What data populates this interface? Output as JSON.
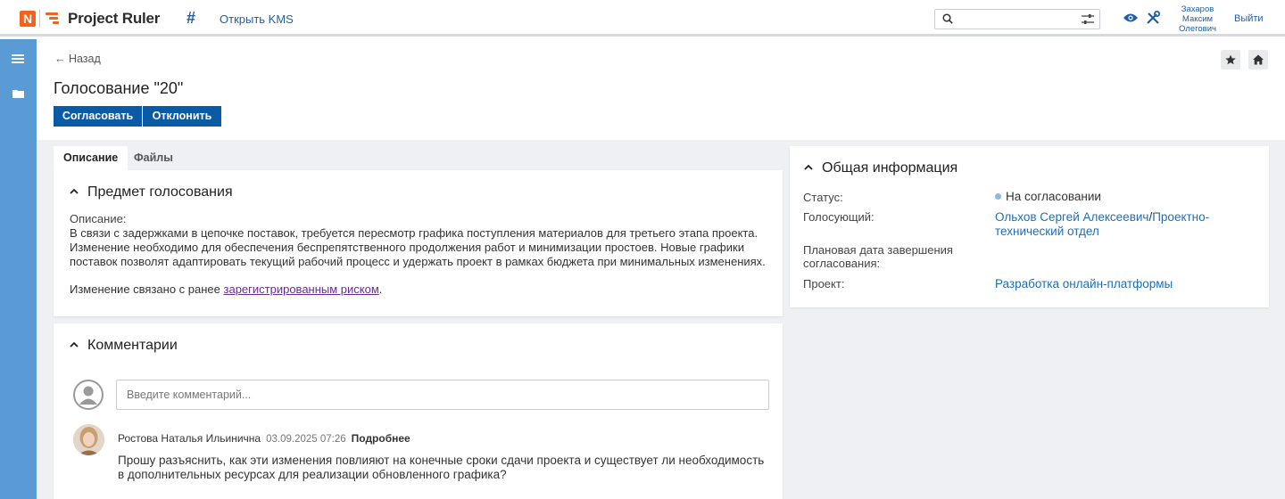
{
  "app": {
    "logo_letter": "N",
    "title": "Project Ruler",
    "kms_link": "Открыть KMS",
    "user_name": "Захаров Максим Олегович",
    "logout": "Выйти",
    "search_value": ""
  },
  "page": {
    "back_label": "← Назад",
    "title": "Голосование \"20\"",
    "approve_label": "Согласовать",
    "reject_label": "Отклонить"
  },
  "tabs": [
    {
      "label": "Описание",
      "active": true
    },
    {
      "label": "Файлы",
      "active": false
    }
  ],
  "subject": {
    "title": "Предмет голосования",
    "description_label": "Описание:",
    "description_text": "В связи с задержками в цепочке поставок, требуется пересмотр графика поступления материалов для третьего этапа проекта. Изменение необходимо для обеспечения беспрепятственного продолжения работ и минимизации простоев. Новые графики поставок позволят адаптировать текущий рабочий процесс и удержать проект в рамках бюджета при минимальных изменениях.",
    "link_prefix": "Изменение связано с ранее ",
    "link_text": "зарегистрированным риском",
    "link_suffix": "."
  },
  "info": {
    "title": "Общая информация",
    "status_label": "Статус:",
    "status_value": "На согласовании",
    "voter_label": "Голосующий:",
    "voter_name": "Ольхов Сергей Алексеевич",
    "voter_sep": "/",
    "voter_department": "Проектно-технический отдел",
    "due_label": "Плановая дата завершения согласования:",
    "due_value": "",
    "project_label": "Проект:",
    "project_value": "Разработка онлайн-платформы"
  },
  "comments": {
    "title": "Комментарии",
    "input_placeholder": "Введите комментарий...",
    "items": [
      {
        "author": "Ростова Наталья Ильинична",
        "date": "03.09.2025 07:26",
        "more_label": "Подробнее",
        "text": "Прошу разъяснить, как эти изменения повлияют на конечные сроки сдачи проекта и существует ли необходимость в дополнительных ресурсах для реализации обновленного графика?"
      }
    ]
  },
  "colors": {
    "accent_orange": "#f0641e",
    "primary_blue": "#0b5aa5",
    "link_blue": "#1e6eb5",
    "rail_blue": "#5b9bd5",
    "content_bg": "#eef0f4"
  },
  "icons": [
    "logo-icon",
    "hash-icon",
    "search-icon",
    "filter-icon",
    "eye-icon",
    "tools-icon",
    "menu-icon",
    "folder-icon",
    "star-icon",
    "home-icon",
    "chevron-up-icon",
    "user-avatar-icon"
  ]
}
